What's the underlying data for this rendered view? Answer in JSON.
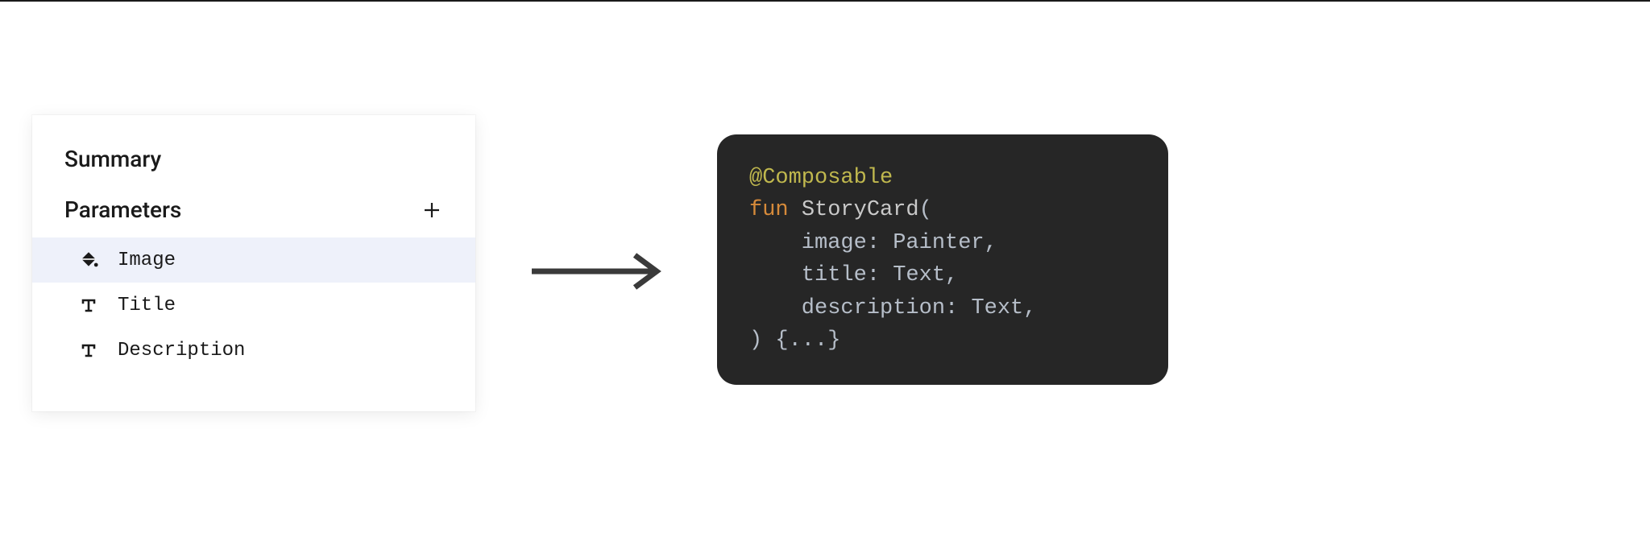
{
  "panel": {
    "summary_title": "Summary",
    "parameters_title": "Parameters",
    "items": [
      {
        "label": "Image",
        "icon": "fill-bucket-icon",
        "selected": true
      },
      {
        "label": "Title",
        "icon": "text-type-icon",
        "selected": false
      },
      {
        "label": "Description",
        "icon": "text-type-icon",
        "selected": false
      }
    ]
  },
  "code": {
    "annotation": "@Composable",
    "keyword_fun": "fun",
    "func_name": "StoryCard",
    "params": [
      {
        "name": "image",
        "type": "Painter"
      },
      {
        "name": "title",
        "type": "Text"
      },
      {
        "name": "description",
        "type": "Text"
      }
    ],
    "body_placeholder": "{...}"
  }
}
